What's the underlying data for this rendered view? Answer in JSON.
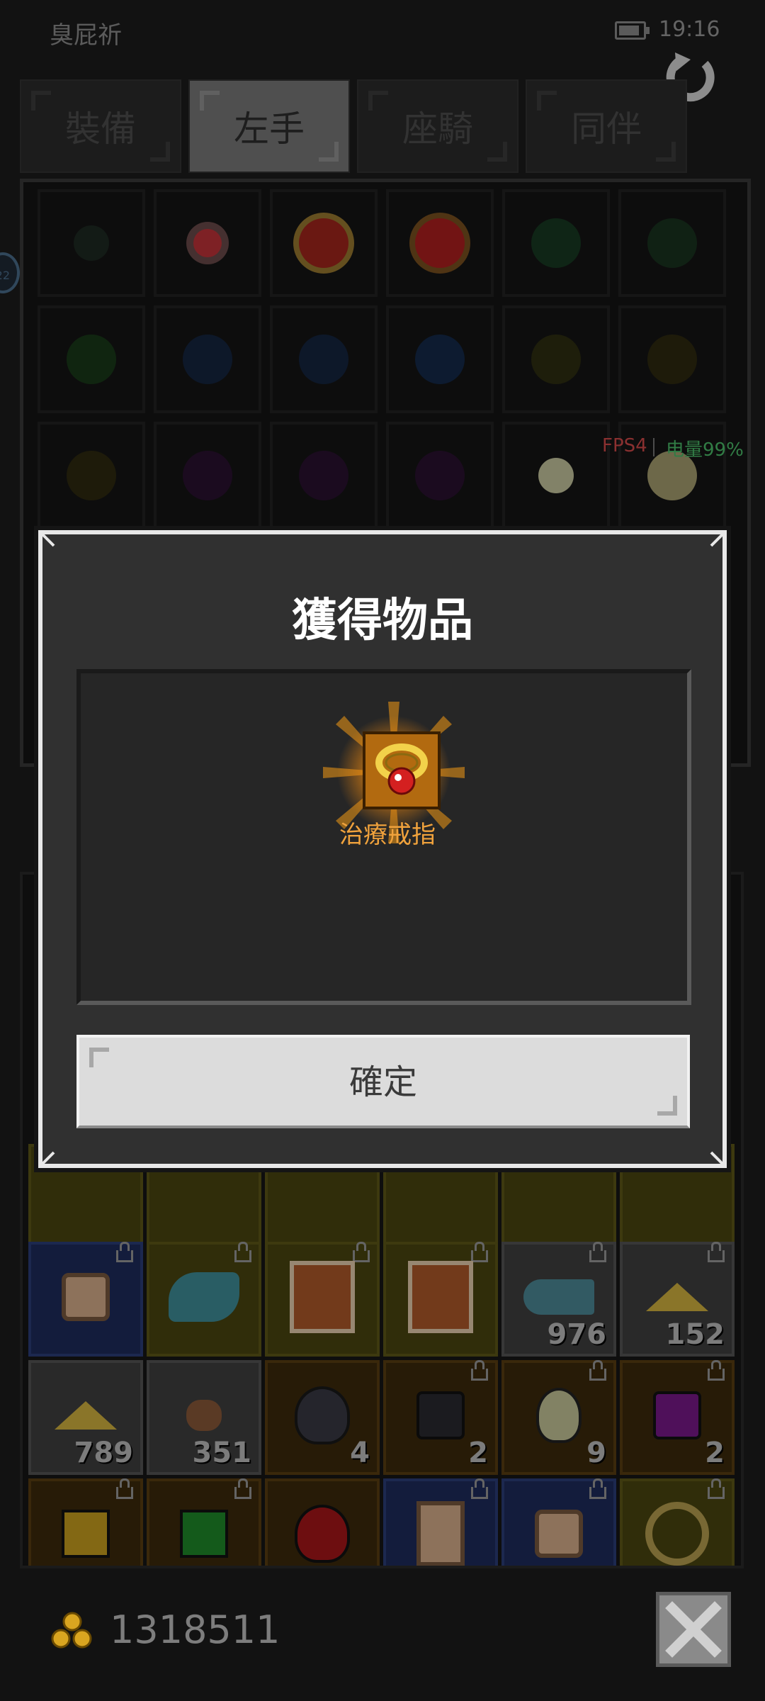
{
  "status_bar": {
    "player_name": "臭屁祈",
    "time": "19:16"
  },
  "tabs": [
    {
      "label": "裝備",
      "active": false
    },
    {
      "label": "左手",
      "active": true
    },
    {
      "label": "座騎",
      "active": false
    },
    {
      "label": "同伴",
      "active": false
    }
  ],
  "overlay": {
    "side_badge": "22",
    "fps": "FPS4",
    "battery": "电量99%"
  },
  "dialog": {
    "title": "獲得物品",
    "item_name": "治療戒指",
    "confirm_label": "確定"
  },
  "inventory": {
    "row1": [
      {
        "color": "blue",
        "qty": ""
      },
      {
        "color": "yellow",
        "qty": ""
      },
      {
        "color": "yellow",
        "qty": ""
      },
      {
        "color": "yellow",
        "qty": ""
      },
      {
        "color": "gray",
        "qty": "976"
      },
      {
        "color": "gray",
        "qty": "152"
      }
    ],
    "row2": [
      {
        "color": "gray",
        "qty": "789"
      },
      {
        "color": "gray",
        "qty": "351"
      },
      {
        "color": "brown",
        "qty": "4"
      },
      {
        "color": "brown",
        "qty": "2"
      },
      {
        "color": "brown",
        "qty": "9"
      },
      {
        "color": "brown",
        "qty": "2"
      }
    ]
  },
  "footer": {
    "gold": "1318511"
  },
  "colors": {
    "accent_orange": "#f0a23c",
    "fps_red": "#d44a4a",
    "battery_green": "#4cbf6a"
  }
}
